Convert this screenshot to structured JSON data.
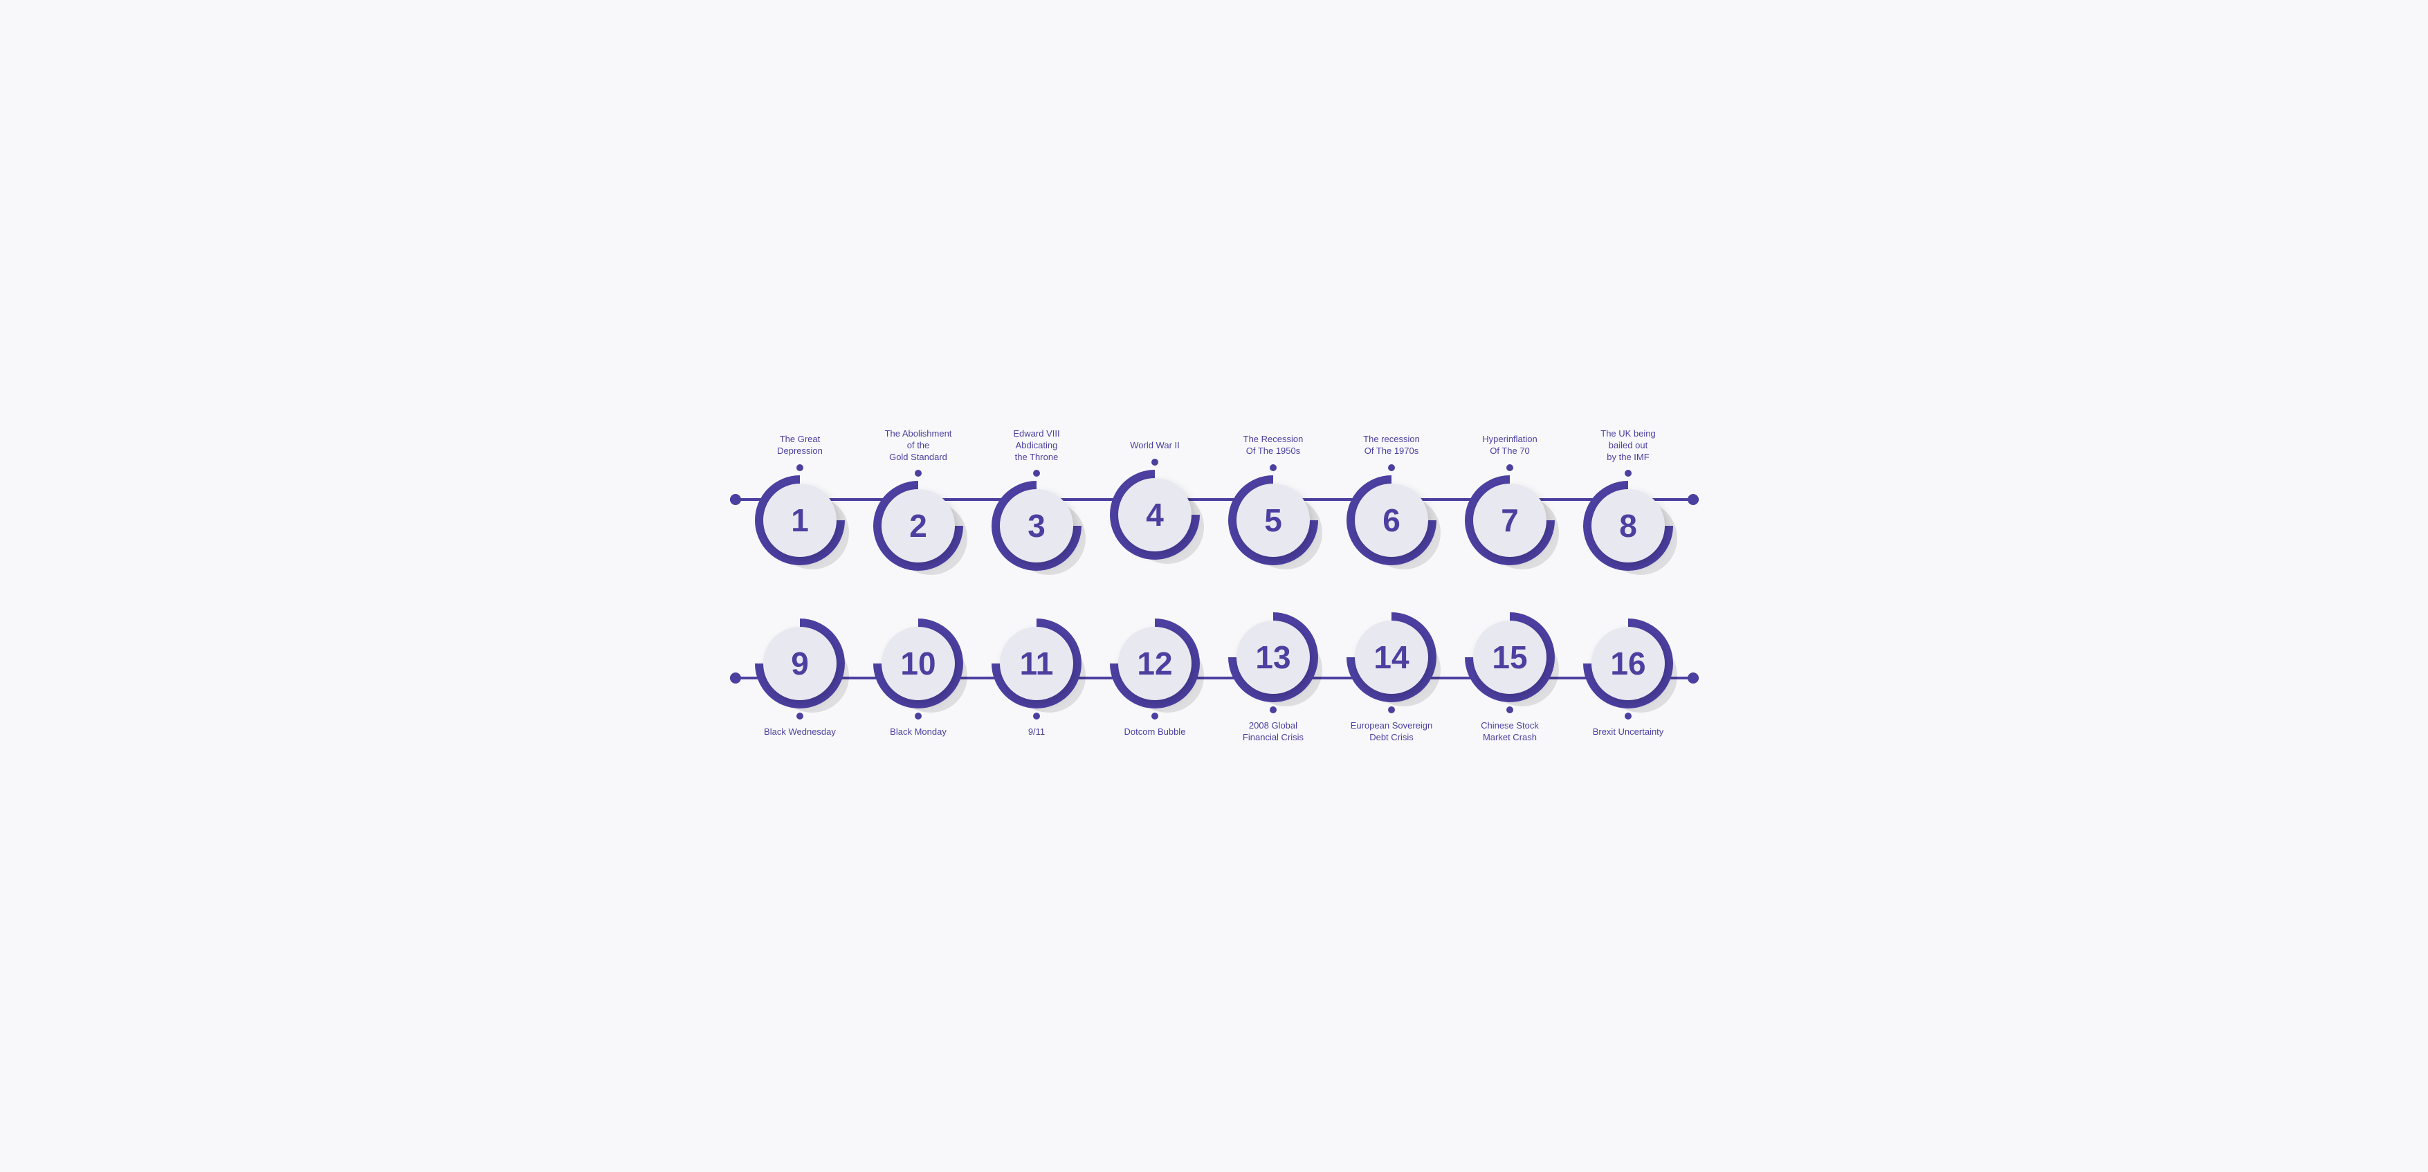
{
  "row1": {
    "items": [
      {
        "number": "1",
        "label": "The Great\nDepression",
        "label_position": "above"
      },
      {
        "number": "2",
        "label": "The Abolishment\nof the\nGold Standard",
        "label_position": "above"
      },
      {
        "number": "3",
        "label": "Edward VIII\nAbdicating\nthe Throne",
        "label_position": "above"
      },
      {
        "number": "4",
        "label": "World War II",
        "label_position": "above"
      },
      {
        "number": "5",
        "label": "The Recession\nOf The 1950s",
        "label_position": "above"
      },
      {
        "number": "6",
        "label": "The recession\nOf The 1970s",
        "label_position": "above"
      },
      {
        "number": "7",
        "label": "Hyperinflation\nOf The 70",
        "label_position": "above"
      },
      {
        "number": "8",
        "label": "The UK being\nbailed out\nby the IMF",
        "label_position": "above"
      }
    ]
  },
  "row2": {
    "items": [
      {
        "number": "9",
        "label": "Black Wednesday",
        "label_position": "below"
      },
      {
        "number": "10",
        "label": "Black Monday",
        "label_position": "below"
      },
      {
        "number": "11",
        "label": "9/11",
        "label_position": "below"
      },
      {
        "number": "12",
        "label": "Dotcom Bubble",
        "label_position": "below"
      },
      {
        "number": "13",
        "label": "2008 Global\nFinancial Crisis",
        "label_position": "below"
      },
      {
        "number": "14",
        "label": "European Sovereign\nDebt Crisis",
        "label_position": "below"
      },
      {
        "number": "15",
        "label": "Chinese Stock\nMarket Crash",
        "label_position": "below"
      },
      {
        "number": "16",
        "label": "Brexit Uncertainty",
        "label_position": "below"
      }
    ]
  }
}
